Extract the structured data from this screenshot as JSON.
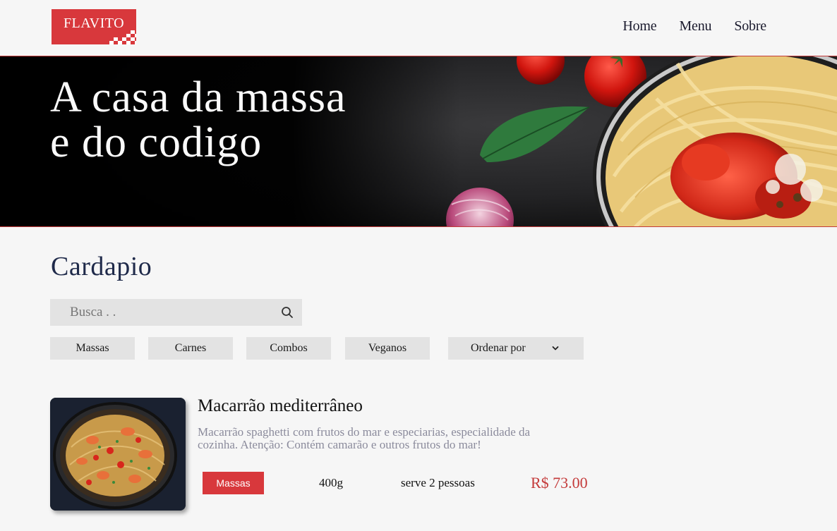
{
  "header": {
    "logo_text": "FLAVITO",
    "nav": [
      "Home",
      "Menu",
      "Sobre"
    ]
  },
  "hero": {
    "title": "A casa da massa e do codigo"
  },
  "menu": {
    "title": "Cardapio",
    "search_placeholder": "Busca . .",
    "filters": [
      "Massas",
      "Carnes",
      "Combos",
      "Veganos"
    ],
    "sort_label": "Ordenar por"
  },
  "dishes": [
    {
      "name": "Macarrão mediterrâneo",
      "description": "Macarrão spaghetti com frutos do mar e especiarias, especialidade da cozinha. Atenção: Contém camarão e outros frutos do mar!",
      "category": "Massas",
      "weight": "400g",
      "serves": "serve 2 pessoas",
      "price": "R$ 73.00"
    }
  ],
  "colors": {
    "accent": "#d8383c",
    "background": "#f6f6f6",
    "chip": "#e3e3e3"
  },
  "icons": {
    "search": "search-icon",
    "sort": "chevron-down-icon"
  }
}
